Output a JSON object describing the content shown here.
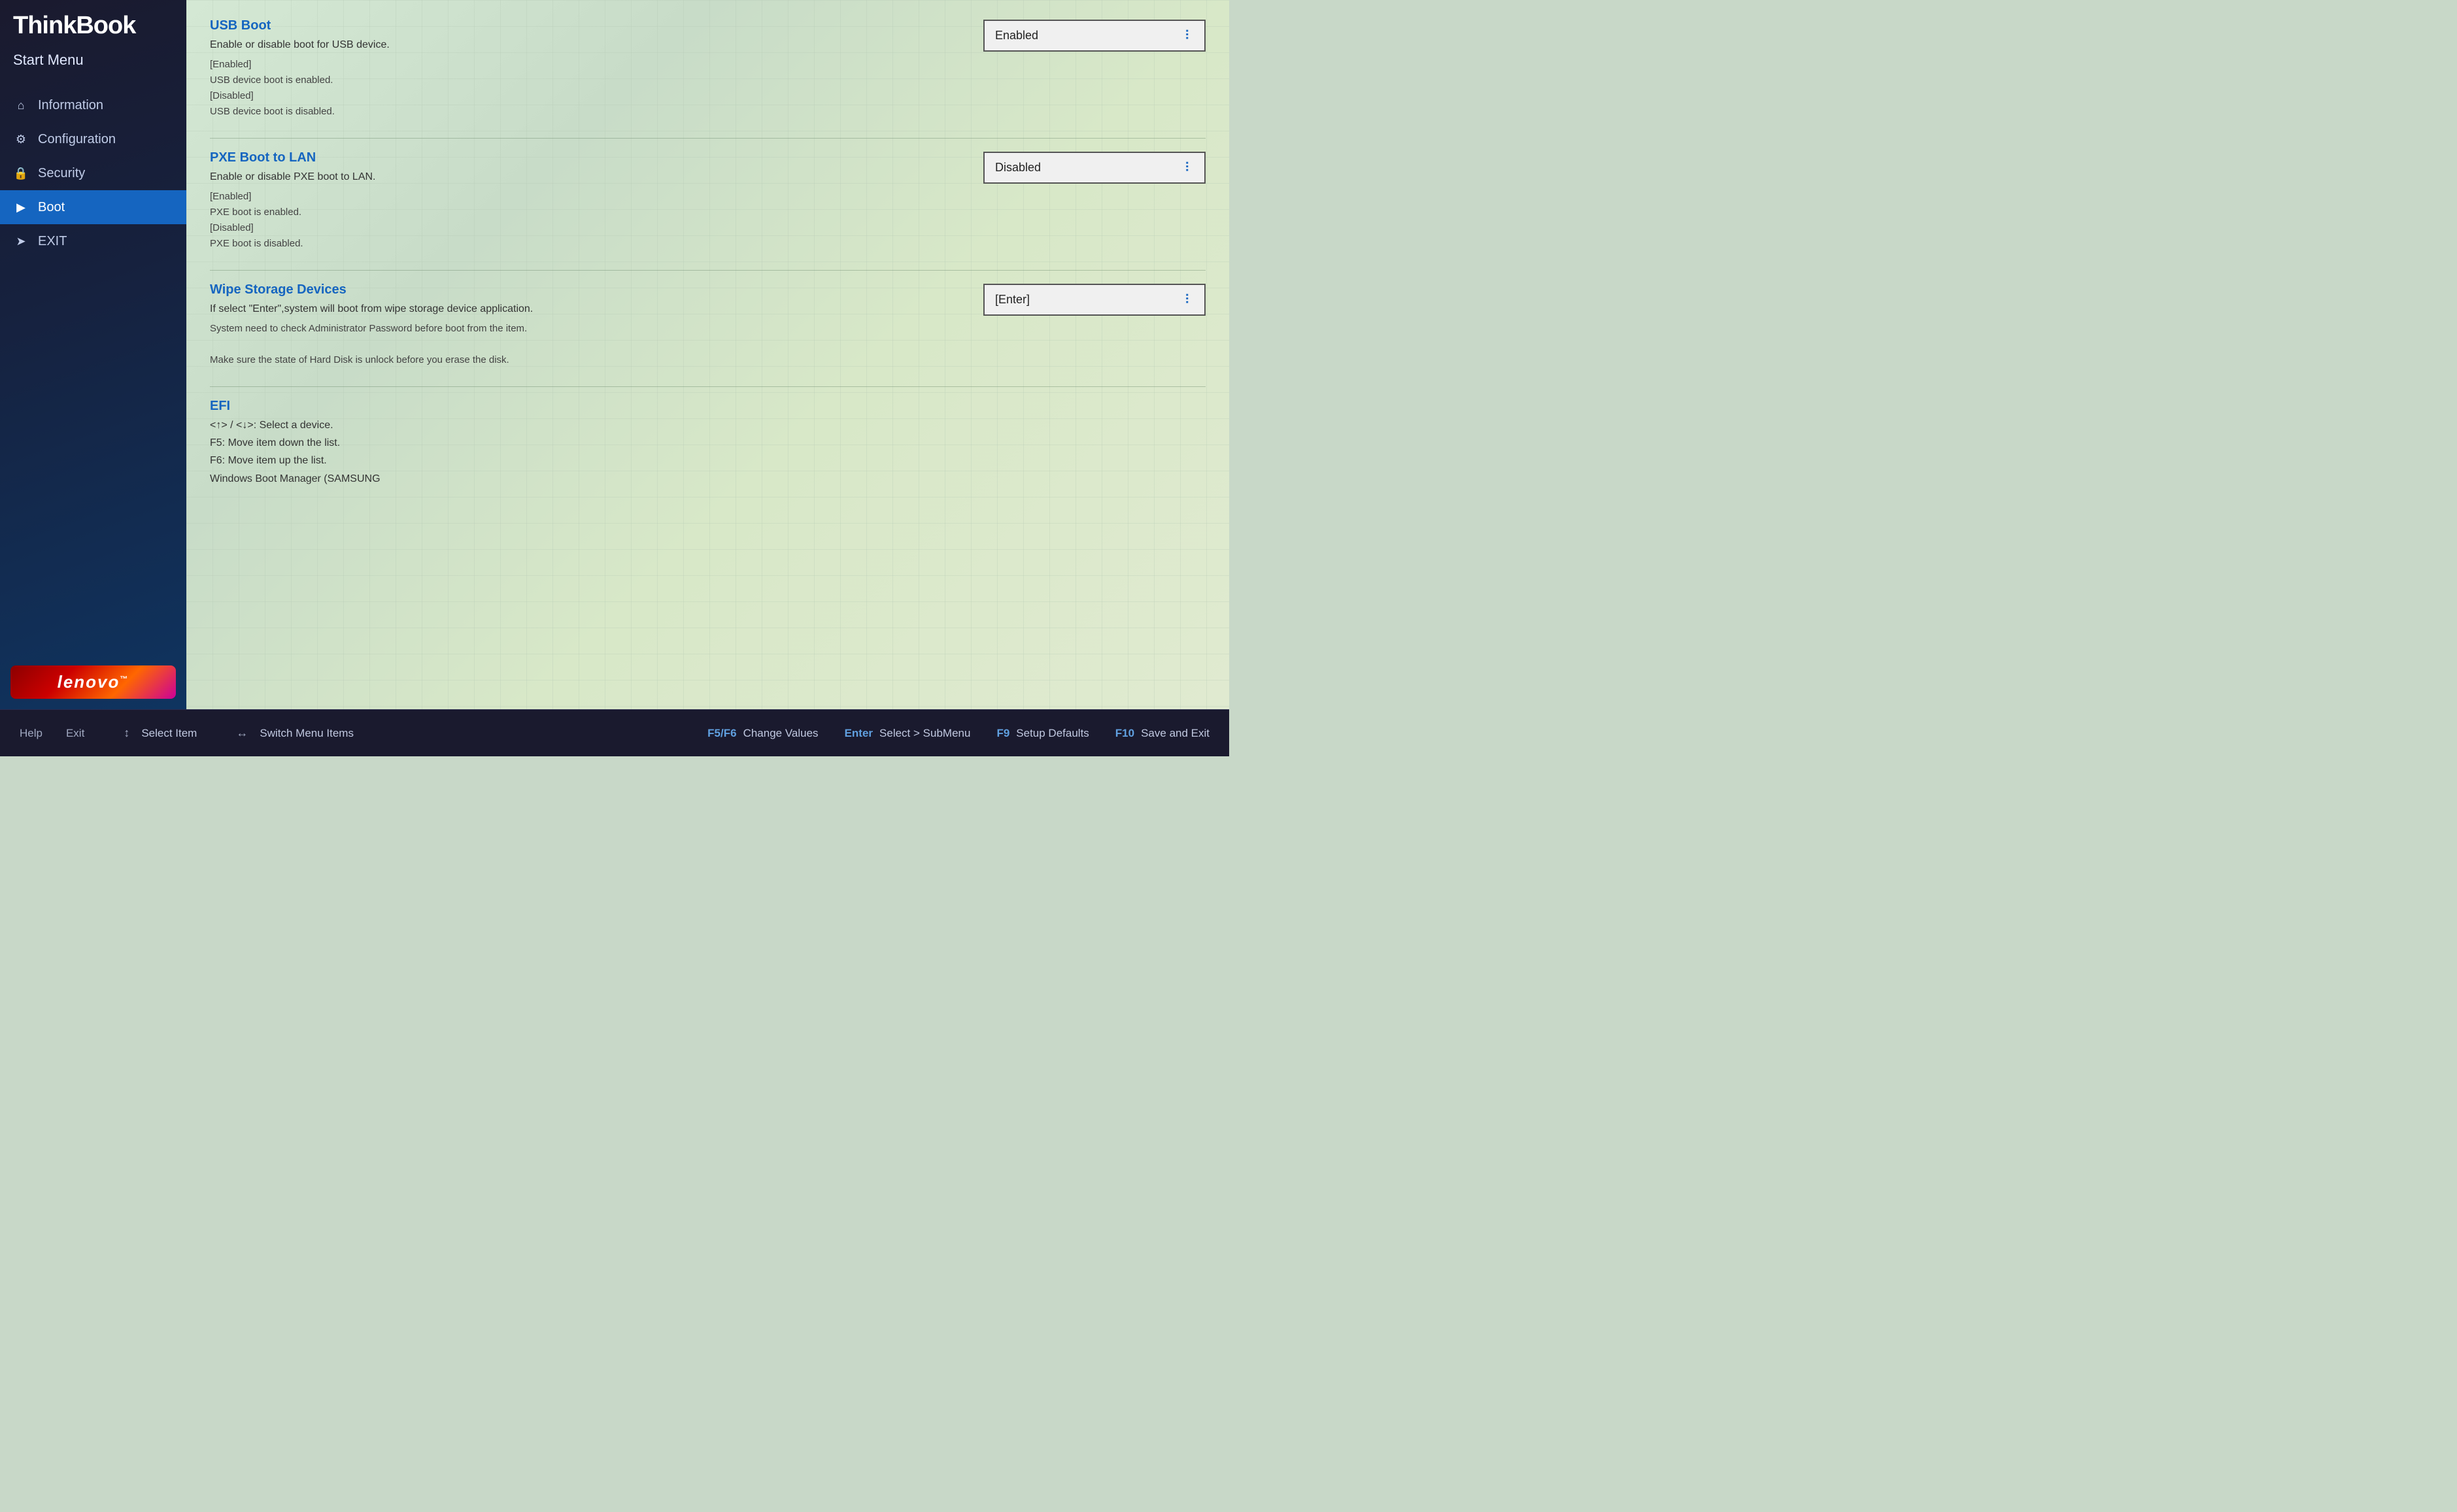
{
  "sidebar": {
    "logo": "ThinkBook",
    "menu_title": "Start Menu",
    "nav_items": [
      {
        "id": "information",
        "label": "Information",
        "icon": "⌂",
        "active": false
      },
      {
        "id": "configuration",
        "label": "Configuration",
        "icon": "⚙",
        "active": false
      },
      {
        "id": "security",
        "label": "Security",
        "icon": "🔒",
        "active": false
      },
      {
        "id": "boot",
        "label": "Boot",
        "icon": "▶",
        "active": true
      },
      {
        "id": "exit",
        "label": "EXIT",
        "icon": "➤",
        "active": false
      }
    ],
    "lenovo_text": "lenovo",
    "lenovo_tm": "™"
  },
  "content": {
    "sections": [
      {
        "id": "usb-boot",
        "title": "USB Boot",
        "description": "Enable or disable boot for USB device.",
        "details": "[Enabled]\nUSB device boot is enabled.\n[Disabled]\nUSB device boot is disabled.",
        "control_type": "dropdown",
        "control_value": "Enabled"
      },
      {
        "id": "pxe-boot",
        "title": "PXE Boot to LAN",
        "description": "Enable or disable PXE boot to LAN.",
        "details": "[Enabled]\nPXE boot is enabled.\n[Disabled]\nPXE boot is disabled.",
        "control_type": "dropdown",
        "control_value": "Disabled"
      },
      {
        "id": "wipe-storage",
        "title": "Wipe Storage Devices",
        "description": "If select \"Enter\",system will boot from wipe storage device application.",
        "details": "System need to check Administrator Password before boot from the item.\n\nMake sure the state of Hard Disk is unlock before you erase the disk.",
        "control_type": "dropdown",
        "control_value": "[Enter]"
      }
    ],
    "efi": {
      "title": "EFI",
      "lines": [
        "<↑> / <↓>: Select a device.",
        "F5: Move item down the list.",
        "F6: Move item up the list.",
        "Windows Boot Manager (SAMSUNG"
      ]
    }
  },
  "bottom_bar": {
    "left": [
      {
        "label": "Help"
      },
      {
        "label": "Exit"
      }
    ],
    "middle": [
      {
        "icon": "↕",
        "action": "Select Item"
      },
      {
        "icon": "↔",
        "action": "Switch Menu Items"
      }
    ],
    "right": [
      {
        "key": "F5/F6",
        "action": "Change Values"
      },
      {
        "key": "Enter",
        "action": "Select > SubMenu"
      },
      {
        "key": "F9",
        "action": "Setup Defaults"
      },
      {
        "key": "F10",
        "action": "Save and Exit"
      }
    ]
  }
}
